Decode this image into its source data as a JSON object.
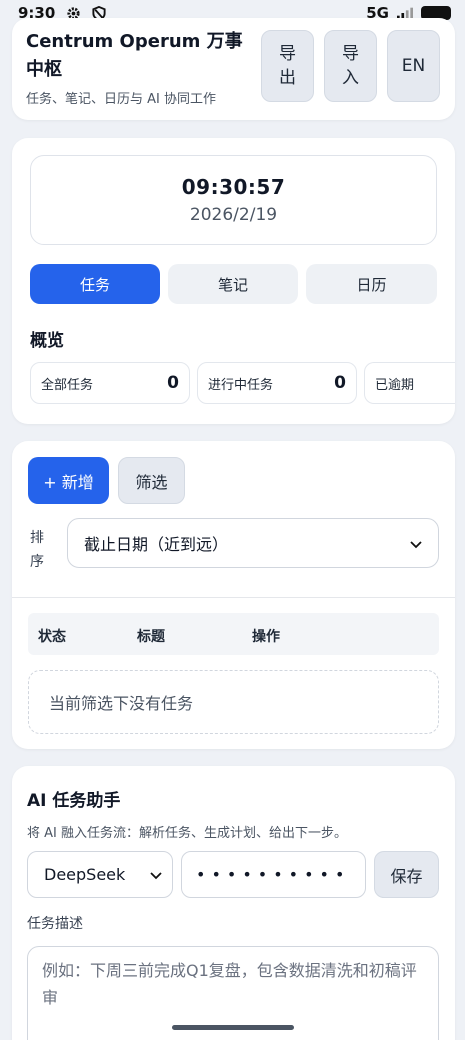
{
  "status_bar": {
    "time": "9:30",
    "network": "5G"
  },
  "header": {
    "title": "Centrum Operum 万事中枢",
    "subtitle": "任务、笔记、日历与 AI 协同工作",
    "export_label": "导出",
    "import_label": "导入",
    "lang_label": "EN"
  },
  "clock": {
    "time": "09:30:57",
    "date": "2026/2/19"
  },
  "tabs": [
    {
      "label": "任务",
      "active": true
    },
    {
      "label": "笔记",
      "active": false
    },
    {
      "label": "日历",
      "active": false
    }
  ],
  "overview": {
    "title": "概览",
    "stats": [
      {
        "label": "全部任务",
        "value": "0"
      },
      {
        "label": "进行中任务",
        "value": "0"
      },
      {
        "label": "已逾期",
        "value": ""
      }
    ]
  },
  "task_list": {
    "add_label": "+ 新增",
    "filter_label": "筛选",
    "sort_label": "排序",
    "sort_value": "截止日期（近到远）",
    "columns": [
      "状态",
      "标题",
      "操作"
    ],
    "empty_text": "当前筛选下没有任务"
  },
  "ai_assistant": {
    "title": "AI 任务助手",
    "subtitle": "将 AI 融入任务流：解析任务、生成计划、给出下一步。",
    "model": "DeepSeek",
    "api_key_masked": "••••••••••",
    "save_label": "保存",
    "desc_label": "任务描述",
    "desc_placeholder": "例如：下周三前完成Q1复盘，包含数据清洗和初稿评审"
  },
  "colors": {
    "accent": "#2563eb",
    "background": "#eef1f6",
    "card": "#ffffff"
  }
}
